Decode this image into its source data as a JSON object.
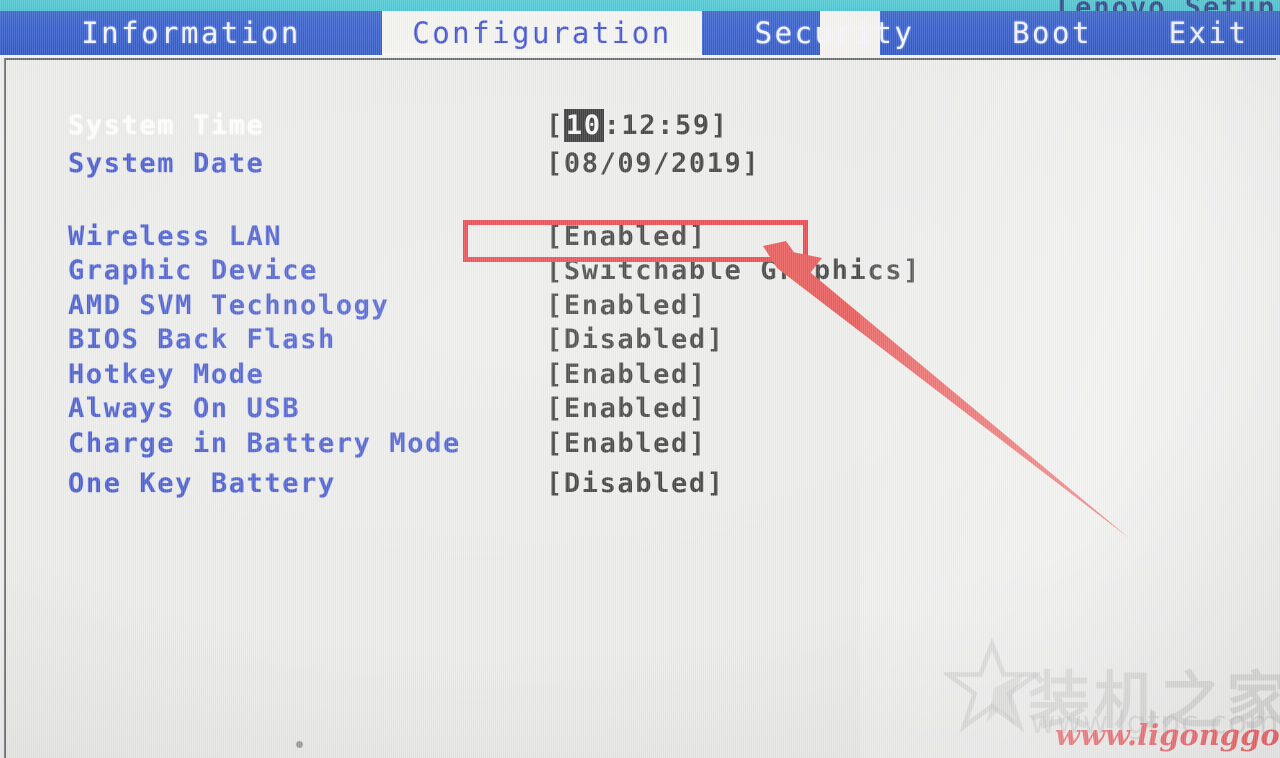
{
  "window": {
    "title": "Lenovo Setup"
  },
  "tabs": [
    {
      "label": "Information",
      "active": false
    },
    {
      "label": "Configuration",
      "active": true
    },
    {
      "label": "Security",
      "active": false
    },
    {
      "label": "Boot",
      "active": false
    },
    {
      "label": "Exit",
      "active": false
    }
  ],
  "settings": [
    {
      "label": "System Time",
      "value": "[10:12:59]",
      "selected": true,
      "highlight_segment": "10"
    },
    {
      "label": "System Date",
      "value": "[08/09/2019]",
      "selected": false
    },
    {
      "label": "Wireless LAN",
      "value": "[Enabled]",
      "selected": false
    },
    {
      "label": "Graphic Device",
      "value": "[Switchable Graphics]",
      "selected": false
    },
    {
      "label": "AMD SVM Technology",
      "value": "[Enabled]",
      "selected": false
    },
    {
      "label": "BIOS Back Flash",
      "value": "[Disabled]",
      "selected": false
    },
    {
      "label": "Hotkey Mode",
      "value": "[Enabled]",
      "selected": false
    },
    {
      "label": "Always On USB",
      "value": "[Enabled]",
      "selected": false
    },
    {
      "label": "Charge in Battery Mode",
      "value": "[Enabled]",
      "selected": false
    },
    {
      "label": "One Key Battery",
      "value": "[Disabled]",
      "selected": false
    }
  ],
  "annotation": {
    "box_target": "Wireless LAN value",
    "arrow_color": "#ec1c24",
    "box_color": "#ec1c24"
  },
  "watermark": {
    "brand_cn": "装机之家",
    "url_faint": "www.lgtpc.com",
    "url_red": "www.ligonggong.com"
  },
  "colors": {
    "tab_bar": "#1446cf",
    "banner": "#2ec3d2",
    "label_blue": "#2a41c9",
    "value_black": "#1b1b1b",
    "screen_bg": "#e9e9e7",
    "accent_red": "#ec1c24"
  }
}
